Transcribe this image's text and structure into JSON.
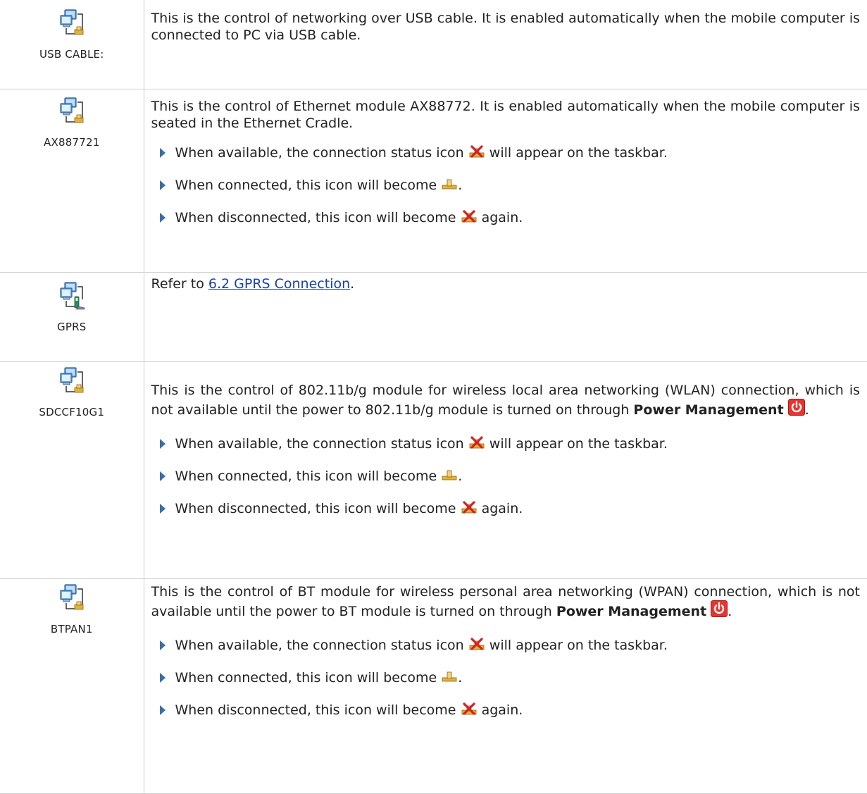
{
  "rows": [
    {
      "label": "USB CABLE:",
      "icon": "network-usb-icon",
      "text": "This is the control of networking over USB cable. It is enabled automatically when the mobile computer is connected to PC via USB cable."
    },
    {
      "label": "AX887721",
      "icon": "network-ethernet-icon",
      "text": "This is the control of Ethernet module AX88772. It is enabled automatically when the mobile computer is seated in the Ethernet Cradle.",
      "bullets": [
        {
          "pre": "When available, the connection status icon",
          "post": "will appear on the taskbar."
        },
        {
          "pre": "When connected, this icon will become",
          "post": "."
        },
        {
          "pre": "When disconnected, this icon will become",
          "post": "again."
        }
      ]
    },
    {
      "label": "GPRS",
      "icon": "network-gprs-icon",
      "refer_prefix": "Refer to",
      "refer_link": "6.2 GPRS Connection",
      "refer_suffix": "."
    },
    {
      "label": "SDCCF10G1",
      "icon": "network-wlan-icon",
      "text": "This is the control of 802.11b/g module for wireless local area networking (WLAN) connection, which is not available until the power to 802.11b/g module is turned on through",
      "bold": "Power Management",
      "end": ".",
      "bullets": [
        {
          "pre": "When available, the connection status icon",
          "post": "will appear on the taskbar."
        },
        {
          "pre": "When connected, this icon will become",
          "post": "."
        },
        {
          "pre": "When disconnected, this icon will become",
          "post": "again."
        }
      ]
    },
    {
      "label": "BTPAN1",
      "icon": "network-bt-icon",
      "text": "This is the control of BT module for wireless personal area networking (WPAN) connection, which is not available until the power to BT module is turned on through",
      "bold": "Power Management",
      "end": ".",
      "bullets": [
        {
          "pre": "When available, the connection status icon",
          "post": "will appear on the taskbar."
        },
        {
          "pre": "When connected, this icon will become",
          "post": "."
        },
        {
          "pre": "When disconnected, this icon will become",
          "post": "again."
        }
      ]
    }
  ],
  "colors": {
    "link": "#1a3fb0",
    "bullet": "#3a6ea5",
    "border": "#cfcfcf",
    "power_icon": "#e8332f"
  }
}
